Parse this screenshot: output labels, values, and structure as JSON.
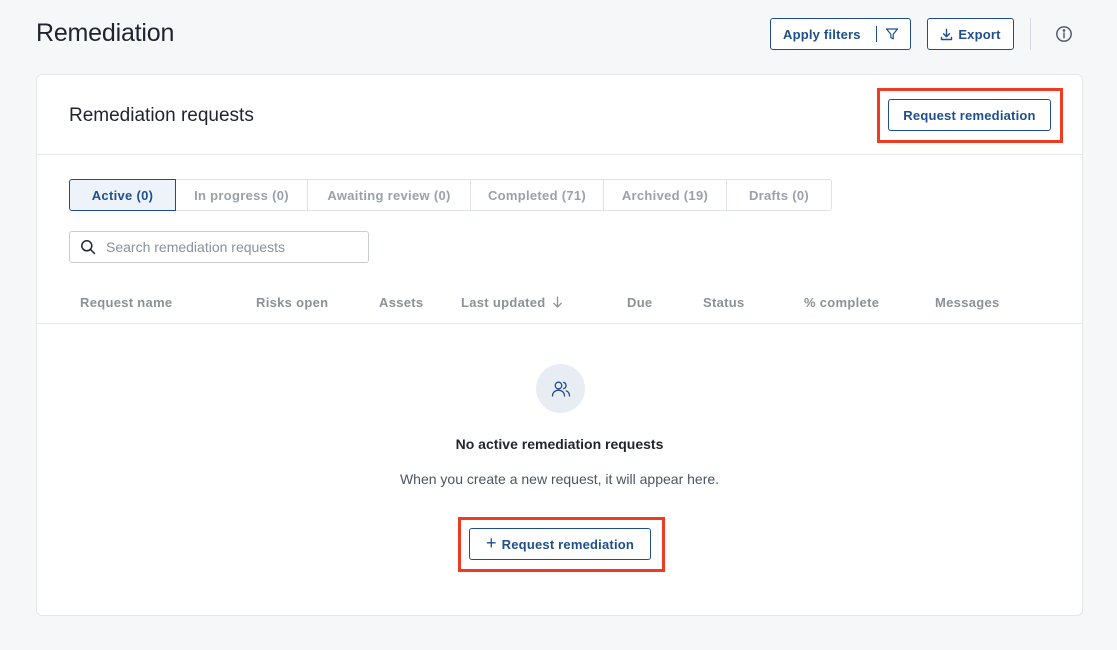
{
  "page": {
    "title": "Remediation"
  },
  "header": {
    "apply_filters_label": "Apply filters",
    "export_label": "Export",
    "icons": {
      "filter": "filter-icon",
      "export": "download-icon",
      "info": "info-icon"
    }
  },
  "card": {
    "title": "Remediation requests",
    "request_button_label": "Request remediation"
  },
  "tabs": [
    {
      "label": "Active (0)",
      "active": true
    },
    {
      "label": "In progress (0)",
      "active": false
    },
    {
      "label": "Awaiting review (0)",
      "active": false
    },
    {
      "label": "Completed (71)",
      "active": false
    },
    {
      "label": "Archived (19)",
      "active": false
    },
    {
      "label": "Drafts (0)",
      "active": false
    }
  ],
  "search": {
    "placeholder": "Search remediation requests",
    "value": ""
  },
  "table": {
    "columns": [
      "Request name",
      "Risks open",
      "Assets",
      "Last updated",
      "Due",
      "Status",
      "% complete",
      "Messages"
    ],
    "sorted_column": "Last updated",
    "sort_direction": "descending"
  },
  "empty_state": {
    "icon": "users-icon",
    "title": "No active remediation requests",
    "subtitle": "When you create a new request, it will appear here.",
    "button_label": "Request remediation"
  },
  "colors": {
    "accent": "#1e4f8c",
    "highlight": "#ee3b22",
    "background": "#f6f7f9"
  }
}
